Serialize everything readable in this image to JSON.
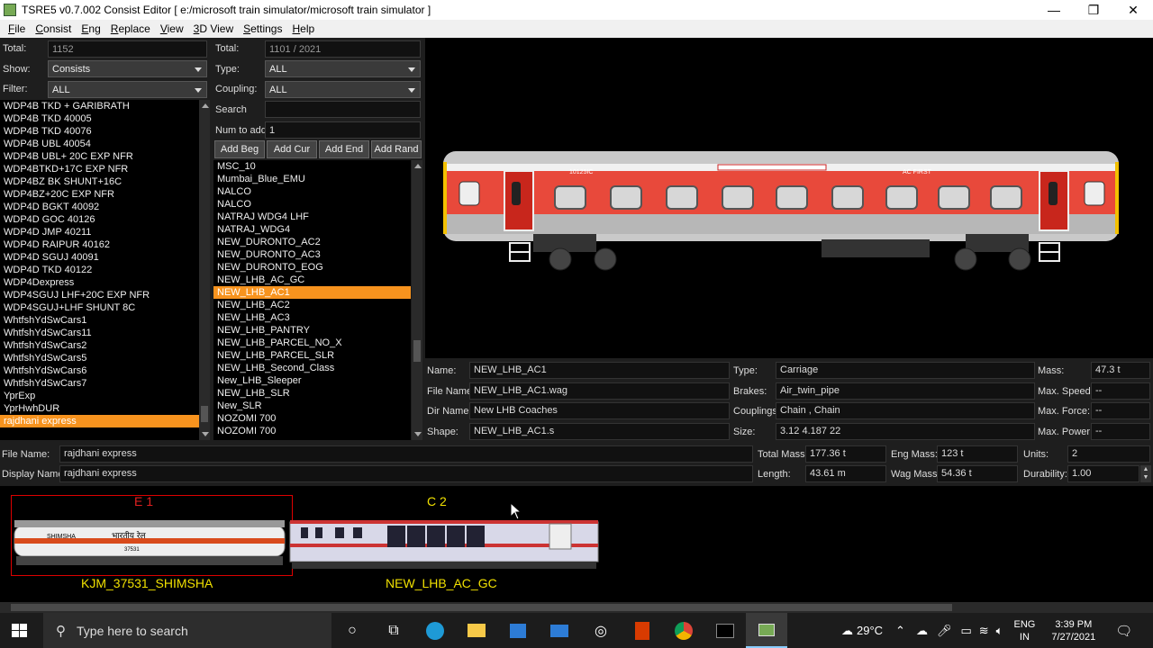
{
  "window": {
    "title": "TSRE5 v0.7.002 Consist Editor   [ e:/microsoft train simulator/microsoft train simulator ]",
    "min": "—",
    "max": "❐",
    "close": "✕"
  },
  "menu": [
    "File",
    "Consist",
    "Eng",
    "Replace",
    "View",
    "3D View",
    "Settings",
    "Help"
  ],
  "left": {
    "total_label": "Total:",
    "total_value": "1152",
    "show_label": "Show:",
    "show_value": "Consists",
    "filter_label": "Filter:",
    "filter_value": "ALL",
    "items": [
      "WDP4B TKD + GARIBRATH",
      "WDP4B TKD 40005",
      "WDP4B TKD 40076",
      "WDP4B UBL 40054",
      "WDP4B UBL+ 20C EXP NFR",
      "WDP4BTKD+17C EXP NFR",
      "WDP4BZ BK SHUNT+16C",
      "WDP4BZ+20C EXP NFR",
      "WDP4D BGKT 40092",
      "WDP4D GOC 40126",
      "WDP4D JMP 40211",
      "WDP4D RAIPUR 40162",
      "WDP4D SGUJ 40091",
      "WDP4D TKD 40122",
      "WDP4Dexpress",
      "WDP4SGUJ LHF+20C EXP NFR",
      "WDP4SGUJ+LHF SHUNT 8C",
      "WhtfshYdSwCars1",
      "WhtfshYdSwCars11",
      "WhtfshYdSwCars2",
      "WhtfshYdSwCars5",
      "WhtfshYdSwCars6",
      "WhtfshYdSwCars7",
      "YprExp",
      "YprHwhDUR",
      "rajdhani express"
    ],
    "selected": 25
  },
  "mid": {
    "total_label": "Total:",
    "total_value": "1101 / 2021",
    "type_label": "Type:",
    "type_value": "ALL",
    "coupling_label": "Coupling:",
    "coupling_value": "ALL",
    "search_label": "Search",
    "search_value": "",
    "num_label": "Num to add",
    "num_value": "1",
    "buttons": [
      "Add Beg",
      "Add Cur",
      "Add End",
      "Add Rand"
    ],
    "items": [
      "MSC_10",
      "Mumbai_Blue_EMU",
      "NALCO",
      "NALCO",
      "NATRAJ WDG4 LHF",
      "NATRAJ_WDG4",
      "NEW_DURONTO_AC2",
      "NEW_DURONTO_AC3",
      "NEW_DURONTO_EOG",
      "NEW_LHB_AC_GC",
      "NEW_LHB_AC1",
      "NEW_LHB_AC2",
      "NEW_LHB_AC3",
      "NEW_LHB_PANTRY",
      "NEW_LHB_PARCEL_NO_X",
      "NEW_LHB_PARCEL_SLR",
      "NEW_LHB_Second_Class",
      "New_LHB_Sleeper",
      "NEW_LHB_SLR",
      "New_SLR",
      "NOZOMI 700",
      "NOZOMI 700"
    ],
    "selected": 10
  },
  "details": {
    "name_label": "Name:",
    "name": "NEW_LHB_AC1",
    "file_label": "File Name:",
    "file": "NEW_LHB_AC1.wag",
    "dir_label": "Dir Name:",
    "dir": "New LHB Coaches",
    "shape_label": "Shape:",
    "shape": "NEW_LHB_AC1.s",
    "type_label": "Type:",
    "type": "Carriage",
    "brakes_label": "Brakes:",
    "brakes": "Air_twin_pipe",
    "couplings_label": "Couplings:",
    "couplings": "Chain , Chain",
    "size_label": "Size:",
    "size": "3.12 4.187 22",
    "mass_label": "Mass:",
    "mass": "47.3 t",
    "speed_label": "Max. Speed:",
    "speed": "--",
    "force_label": "Max. Force:",
    "force": "--",
    "power_label": "Max. Power:",
    "power": "--"
  },
  "consist": {
    "file_label": "File Name:",
    "file": "rajdhani express",
    "display_label": "Display Name:",
    "display": "rajdhani express",
    "totalmass_label": "Total Mass:",
    "totalmass": "177.36 t",
    "length_label": "Length:",
    "length": "43.61 m",
    "engmass_label": "Eng Mass:",
    "engmass": "123 t",
    "wagmass_label": "Wag Mass:",
    "wagmass": "54.36 t",
    "units_label": "Units:",
    "units": "2",
    "durability_label": "Durability:",
    "durability": "1.00"
  },
  "coach_text": {
    "number": "10125IC",
    "class": "AC FIRST"
  },
  "train": [
    {
      "tag": "E 1",
      "name": "KJM_37531_SHIMSHA",
      "logo": "SHIMSHA",
      "hindi": "भारतीय रेल",
      "num": "37531"
    },
    {
      "tag": "C 2",
      "name": "NEW_LHB_AC_GC"
    }
  ],
  "taskbar": {
    "search_placeholder": "Type here to search",
    "weather": "29°C",
    "lang1": "ENG",
    "lang2": "IN",
    "time": "3:39 PM",
    "date": "7/27/2021"
  }
}
